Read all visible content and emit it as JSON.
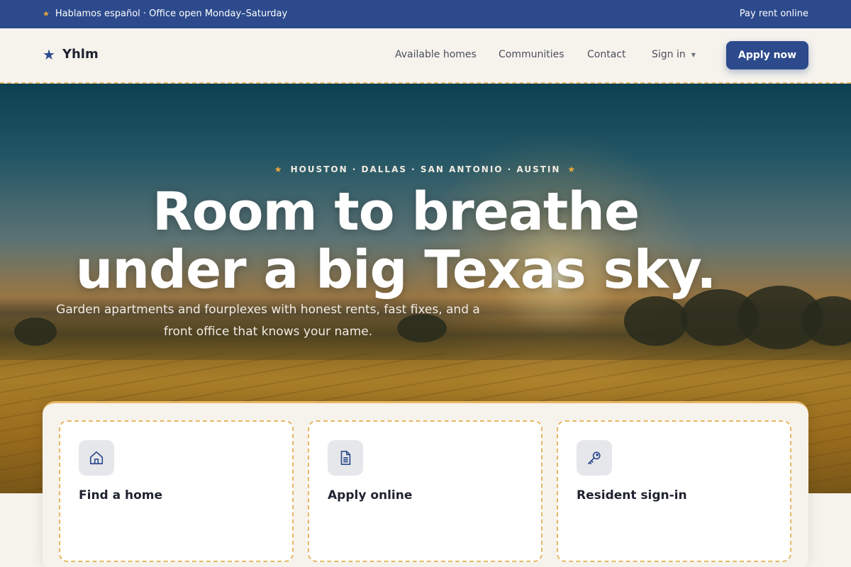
{
  "topbar": {
    "announcement": "Hablamos español · Office open Monday–Saturday",
    "pay_rent": "Pay rent online"
  },
  "brand": {
    "name": "Yhlm",
    "icon": "star-icon"
  },
  "nav": {
    "items": [
      "Available homes",
      "Communities",
      "Contact"
    ],
    "sign_in": "Sign in",
    "apply": "Apply now"
  },
  "hero": {
    "eyebrow": "HOUSTON · DALLAS · SAN ANTONIO · AUSTIN",
    "headline_line1": "Room to breathe",
    "headline_line2": "under a big Texas sky.",
    "subtitle_line1": "Garden apartments and fourplexes with honest rents, fast fixes, and a",
    "subtitle_line2": "front office that knows your name."
  },
  "cards": [
    {
      "title": "Find a home",
      "icon": "house-icon"
    },
    {
      "title": "Apply online",
      "icon": "document-icon"
    },
    {
      "title": "Resident sign-in",
      "icon": "key-icon"
    }
  ],
  "colors": {
    "primary": "#2c4a8c",
    "accent": "#e9a83a",
    "background": "#f6f3ed"
  }
}
